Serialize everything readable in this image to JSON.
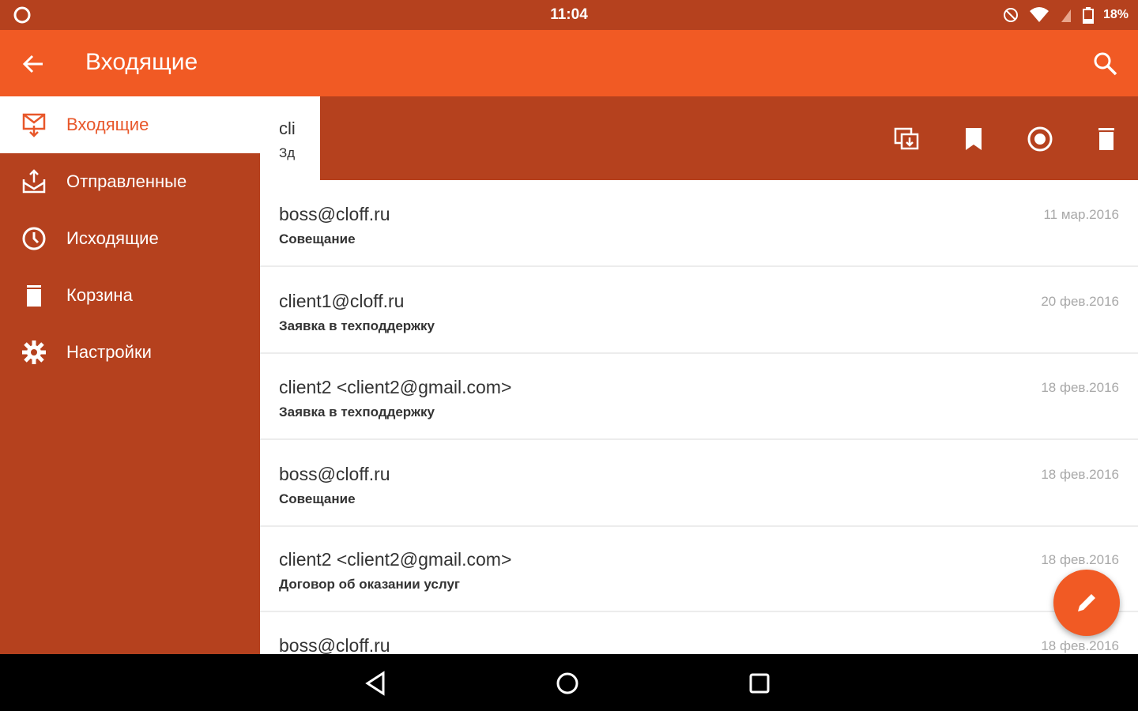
{
  "status_bar": {
    "time": "11:04",
    "battery": "18%",
    "icons": [
      "app-icon",
      "dnd-icon",
      "wifi-icon",
      "no-sim-icon",
      "battery-icon"
    ]
  },
  "app_bar": {
    "title": "Входящие",
    "icons": [
      "back-arrow-icon",
      "search-icon"
    ]
  },
  "drawer": {
    "items": [
      {
        "label": "Входящие",
        "icon": "inbox-icon",
        "active": true
      },
      {
        "label": "Отправленные",
        "icon": "sent-icon"
      },
      {
        "label": "Исходящие",
        "icon": "clock-icon"
      },
      {
        "label": "Корзина",
        "icon": "trash-icon"
      },
      {
        "label": "Настройки",
        "icon": "gear-icon"
      }
    ]
  },
  "selection_bar": {
    "peek_from": "cli",
    "peek_subject": "Зд",
    "actions": [
      "copy-icon",
      "bookmark-icon",
      "mark-read-icon",
      "delete-icon"
    ]
  },
  "messages": [
    {
      "from": "boss@cloff.ru",
      "subject": "Совещание",
      "date": "11 мар.2016"
    },
    {
      "from": "client1@cloff.ru",
      "subject": "Заявка в техподдержку",
      "date": "20 фев.2016"
    },
    {
      "from": "client2 <client2@gmail.com>",
      "subject": "Заявка в техподдержку",
      "date": "18 фев.2016"
    },
    {
      "from": "boss@cloff.ru",
      "subject": "Совещание",
      "date": "18 фев.2016"
    },
    {
      "from": "client2 <client2@gmail.com>",
      "subject": "Договор об оказании услуг",
      "date": "18 фев.2016"
    },
    {
      "from": "boss@cloff.ru",
      "subject": "",
      "date": "18 фев.2016"
    }
  ],
  "fab": {
    "icon": "pencil-icon"
  },
  "nav_bar": {
    "icons": [
      "back-triangle-icon",
      "home-circle-icon",
      "recents-square-icon"
    ]
  },
  "colors": {
    "primary": "#f15a24",
    "primary_dark": "#b5411e",
    "background": "#ffffff"
  }
}
